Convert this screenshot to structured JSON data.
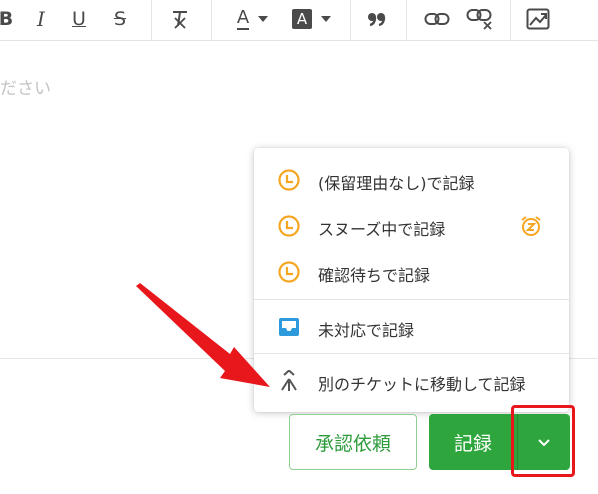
{
  "toolbar": {
    "buttons": [
      {
        "name": "bold-button",
        "label": "B"
      },
      {
        "name": "italic-button",
        "label": "I"
      },
      {
        "name": "underline-button",
        "label": "U"
      },
      {
        "name": "strikethrough-button",
        "label": "S"
      },
      {
        "name": "clear-format-button",
        "icon": "clear-format-icon"
      },
      {
        "name": "text-color-button",
        "label": "A",
        "icon": "text-color-icon"
      },
      {
        "name": "highlight-color-button",
        "label": "A",
        "icon": "highlight-icon"
      },
      {
        "name": "quote-button",
        "icon": "quote-icon"
      },
      {
        "name": "link-button",
        "icon": "link-icon"
      },
      {
        "name": "unlink-button",
        "icon": "unlink-icon"
      },
      {
        "name": "image-button",
        "icon": "image-icon"
      }
    ]
  },
  "editor": {
    "placeholder_fragment": "ださい"
  },
  "menu": {
    "items": [
      {
        "label": "(保留理由なし)で記録",
        "icon": "clock-icon"
      },
      {
        "label": "スヌーズ中で記録",
        "icon": "clock-icon",
        "trailing_icon": "snooze-alarm-icon"
      },
      {
        "label": "確認待ちで記録",
        "icon": "clock-icon"
      },
      {
        "label": "未対応で記録",
        "icon": "inbox-icon"
      },
      {
        "label": "別のチケットに移動して記録",
        "icon": "merge-arrow-icon"
      }
    ]
  },
  "footer": {
    "approve_label": "承認依頼",
    "record_label": "記録",
    "dropdown_icon": "chevron-down-icon"
  },
  "colors": {
    "accent_green": "#2fa63d",
    "clock_orange": "#f5a623",
    "inbox_blue": "#2d9bdb",
    "annotation_red": "#e8171c"
  }
}
